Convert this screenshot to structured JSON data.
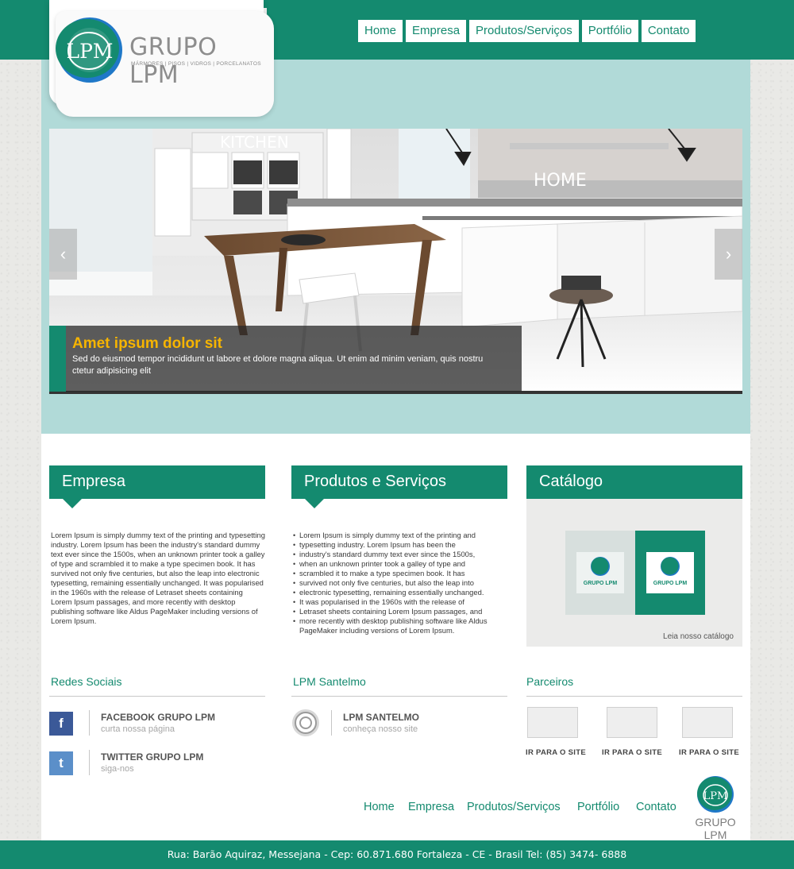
{
  "brand": {
    "name": "GRUPO LPM",
    "monogram": "LPM",
    "tagline": "MÁRMORES | PISOS | VIDROS | PORCELANATOS"
  },
  "nav": [
    "Home",
    "Empresa",
    "Produtos/Serviços",
    "Portfólio",
    "Contato"
  ],
  "slider": {
    "caption_title": "Amet ipsum dolor sit",
    "caption_text": "Sed do eiusmod tempor incididunt ut labore et dolore magna aliqua. Ut enim ad minim veniam, quis nostru ctetur adipisicing elit",
    "prev_icon": "‹",
    "next_icon": "›",
    "scene_text": [
      "KITCHEN",
      "HOME"
    ]
  },
  "empresa": {
    "title": "Empresa",
    "text": "Lorem Ipsum is simply dummy text of the printing and typesetting industry. Lorem Ipsum has been the industry's standard dummy text ever since the 1500s, when an unknown printer took a galley of type and scrambled it to make a type specimen book. It has survived not only five centuries, but also the leap into electronic typesetting, remaining essentially unchanged. It was popularised in the 1960s with the release of Letraset sheets containing Lorem Ipsum passages, and more recently with desktop publishing software like Aldus PageMaker including versions of Lorem Ipsum."
  },
  "produtos": {
    "title": "Produtos e Serviços",
    "items": [
      "Lorem Ipsum is simply dummy text of the printing and",
      "typesetting industry. Lorem Ipsum has been the",
      "industry's standard dummy text ever since the 1500s,",
      "when an unknown printer took a galley of type and",
      "scrambled it to make a type specimen book. It has",
      "survived not only five centuries, but also the leap into",
      "electronic typesetting, remaining essentially unchanged.",
      "It was popularised in the 1960s with the release of",
      "Letraset sheets containing Lorem Ipsum passages, and",
      "more recently with desktop publishing software like Aldus PageMaker including versions of Lorem Ipsum."
    ]
  },
  "catalogo": {
    "title": "Catálogo",
    "link": "Leia nosso catálogo",
    "mini_logo_name": "GRUPO LPM"
  },
  "redes": {
    "title": "Redes Sociais",
    "items": [
      {
        "icon": "f",
        "title": "FACEBOOK GRUPO LPM",
        "sub": "curta nossa página",
        "color": "#3b5998"
      },
      {
        "icon": "t",
        "title": "TWITTER GRUPO LPM",
        "sub": "siga-nos",
        "color": "#5b8fc9"
      }
    ]
  },
  "santelmo": {
    "title": "LPM Santelmo",
    "item": {
      "title": "LPM SANTELMO",
      "sub": "conheça nosso site"
    }
  },
  "parceiros": {
    "title": "Parceiros",
    "link": "IR PARA O SITE"
  },
  "footer_nav": [
    "Home",
    "Empresa",
    "Produtos/Serviços",
    "Portfólio",
    "Contato"
  ],
  "address": "Rua: Barão Aquiraz, Messejana - Cep: 60.871.680 Fortaleza - CE - Brasil Tel: (85) 3474- 6888",
  "colors": {
    "brand_green": "#148a6f",
    "hero_bg": "#b1dad8",
    "caption_accent": "#f6b400",
    "logo_blue": "#1f78c8"
  }
}
